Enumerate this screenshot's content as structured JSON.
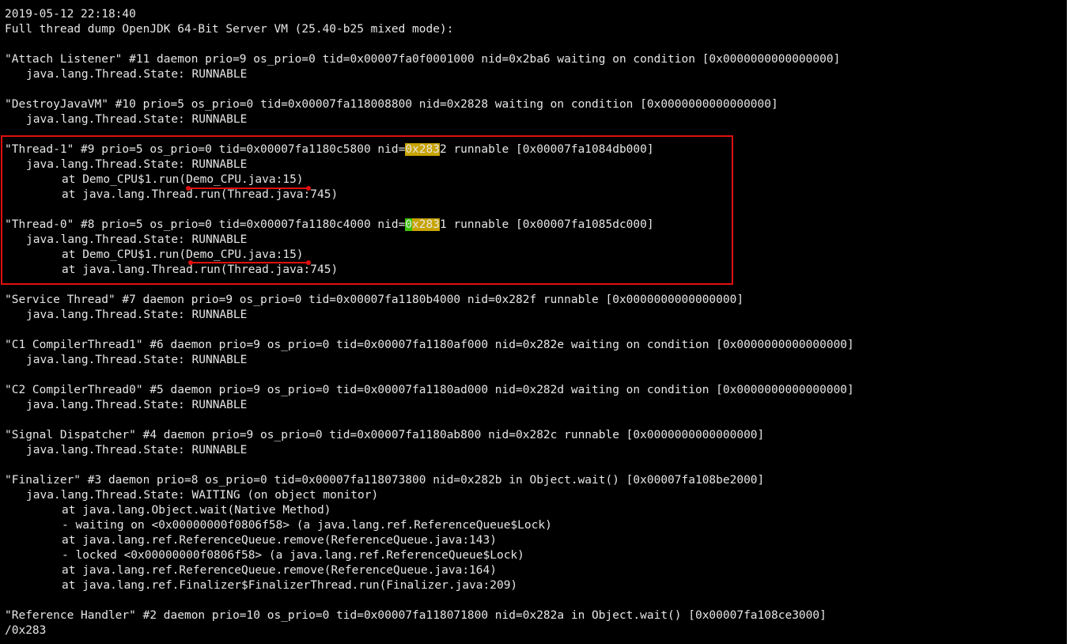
{
  "terminal": {
    "lines": [
      {
        "text": "2019-05-12 22:18:40"
      },
      {
        "text": "Full thread dump OpenJDK 64-Bit Server VM (25.40-b25 mixed mode):"
      },
      {
        "text": ""
      },
      {
        "text": "\"Attach Listener\" #11 daemon prio=9 os_prio=0 tid=0x00007fa0f0001000 nid=0x2ba6 waiting on condition [0x0000000000000000]"
      },
      {
        "text": "java.lang.Thread.State: RUNNABLE"
      },
      {
        "text": ""
      },
      {
        "text": "\"DestroyJavaVM\" #10 prio=5 os_prio=0 tid=0x00007fa118008800 nid=0x2828 waiting on condition [0x0000000000000000]"
      },
      {
        "text": "java.lang.Thread.State: RUNNABLE"
      },
      {
        "text": ""
      },
      {
        "pre": "\"Thread-1\" #9 prio=5 os_prio=0 tid=0x00007fa1180c5800 nid=",
        "hl1": "0x283",
        "post": "2 runnable [0x00007fa1084db000]"
      },
      {
        "text": "java.lang.Thread.State: RUNNABLE"
      },
      {
        "text": "at Demo_CPU$1.run(Demo_CPU.java:15)"
      },
      {
        "text": "at java.lang.Thread.run(Thread.java:745)"
      },
      {
        "text": ""
      },
      {
        "pre": "\"Thread-0\" #8 prio=5 os_prio=0 tid=0x00007fa1180c4000 nid=",
        "hl1": "0",
        "hl2": "x283",
        "post": "1 runnable [0x00007fa1085dc000]"
      },
      {
        "text": "java.lang.Thread.State: RUNNABLE"
      },
      {
        "text": "at Demo_CPU$1.run(Demo_CPU.java:15)"
      },
      {
        "text": "at java.lang.Thread.run(Thread.java:745)"
      },
      {
        "text": ""
      },
      {
        "text": "\"Service Thread\" #7 daemon prio=9 os_prio=0 tid=0x00007fa1180b4000 nid=0x282f runnable [0x0000000000000000]"
      },
      {
        "text": "java.lang.Thread.State: RUNNABLE"
      },
      {
        "text": ""
      },
      {
        "text": "\"C1 CompilerThread1\" #6 daemon prio=9 os_prio=0 tid=0x00007fa1180af000 nid=0x282e waiting on condition [0x0000000000000000]"
      },
      {
        "text": "java.lang.Thread.State: RUNNABLE"
      },
      {
        "text": ""
      },
      {
        "text": "\"C2 CompilerThread0\" #5 daemon prio=9 os_prio=0 tid=0x00007fa1180ad000 nid=0x282d waiting on condition [0x0000000000000000]"
      },
      {
        "text": "java.lang.Thread.State: RUNNABLE"
      },
      {
        "text": ""
      },
      {
        "text": "\"Signal Dispatcher\" #4 daemon prio=9 os_prio=0 tid=0x00007fa1180ab800 nid=0x282c runnable [0x0000000000000000]"
      },
      {
        "text": "java.lang.Thread.State: RUNNABLE"
      },
      {
        "text": ""
      },
      {
        "text": "\"Finalizer\" #3 daemon prio=8 os_prio=0 tid=0x00007fa118073800 nid=0x282b in Object.wait() [0x00007fa108be2000]"
      },
      {
        "text": "java.lang.Thread.State: WAITING (on object monitor)"
      },
      {
        "text": "at java.lang.Object.wait(Native Method)"
      },
      {
        "text": "- waiting on <0x00000000f0806f58> (a java.lang.ref.ReferenceQueue$Lock)"
      },
      {
        "text": "at java.lang.ref.ReferenceQueue.remove(ReferenceQueue.java:143)"
      },
      {
        "text": "- locked <0x00000000f0806f58> (a java.lang.ref.ReferenceQueue$Lock)"
      },
      {
        "text": "at java.lang.ref.ReferenceQueue.remove(ReferenceQueue.java:164)"
      },
      {
        "text": "at java.lang.ref.Finalizer$FinalizerThread.run(Finalizer.java:209)"
      },
      {
        "text": ""
      },
      {
        "text": "\"Reference Handler\" #2 daemon prio=10 os_prio=0 tid=0x00007fa118071800 nid=0x282a in Object.wait() [0x00007fa108ce3000]"
      },
      {
        "text": "/0x283"
      }
    ]
  },
  "annotations": {
    "box_color": "#e01010",
    "highlight_gold": "#c8a400",
    "highlight_green": "#39c400"
  }
}
